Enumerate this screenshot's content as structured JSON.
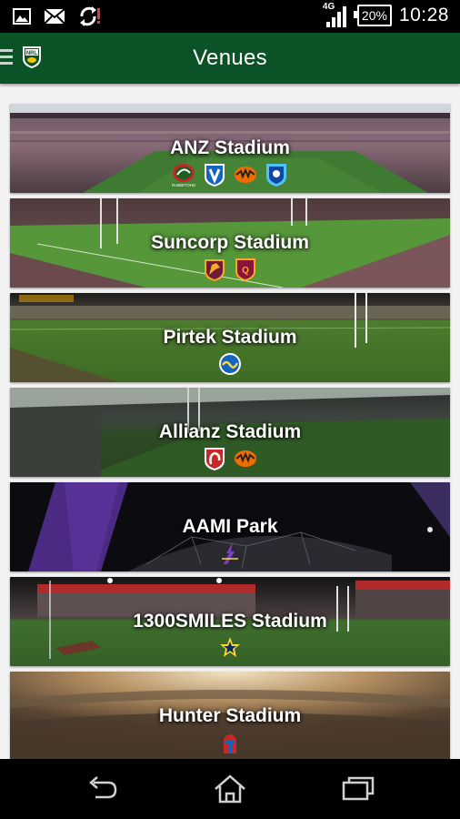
{
  "status_bar": {
    "time": "10:28",
    "battery": "20%",
    "network": "4G",
    "icons": [
      "image-icon",
      "mail-muted-icon",
      "sync-alert-icon"
    ]
  },
  "app_bar": {
    "title": "Venues",
    "logo_text": "NRL",
    "icons": [
      "menu-icon",
      "nrl-logo"
    ]
  },
  "venues": [
    {
      "name": "ANZ Stadium",
      "teams": [
        "rabbitohs",
        "bulldogs",
        "wests-tigers",
        "nsw-blues"
      ],
      "team_labels": [
        "RABBITOHS"
      ]
    },
    {
      "name": "Suncorp Stadium",
      "teams": [
        "broncos",
        "queensland-maroons"
      ]
    },
    {
      "name": "Pirtek Stadium",
      "teams": [
        "eels"
      ]
    },
    {
      "name": "Allianz Stadium",
      "teams": [
        "roosters",
        "wests-tigers"
      ]
    },
    {
      "name": "AAMI Park",
      "teams": [
        "storm"
      ]
    },
    {
      "name": "1300SMILES Stadium",
      "teams": [
        "cowboys"
      ]
    },
    {
      "name": "Hunter Stadium",
      "teams": [
        "knights"
      ]
    }
  ],
  "nav_bar": {
    "icons": [
      "back-icon",
      "home-icon",
      "recent-apps-icon"
    ]
  },
  "colors": {
    "app_bar": "#0b5226",
    "background": "#f2f2f2",
    "status_bar": "#000000"
  }
}
